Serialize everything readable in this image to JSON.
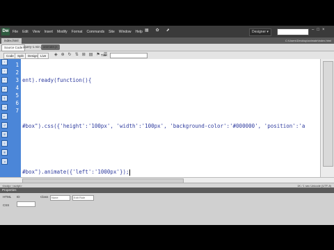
{
  "app": {
    "logo": "Dw",
    "menu": [
      "File",
      "Edit",
      "View",
      "Insert",
      "Modify",
      "Format",
      "Commands",
      "Site",
      "Window",
      "Help"
    ],
    "menu_tools": [
      "▦",
      "✿",
      "⬈"
    ],
    "workspace": "Designer ▾",
    "window_controls": [
      "–",
      "□",
      "×"
    ]
  },
  "doc": {
    "tab": "index.html",
    "path": "C:\\Users\\Desktop\\animate\\index.html",
    "related": [
      "Source Code",
      "jquery-1.min.js",
      "animate.js"
    ]
  },
  "toolbar": {
    "code": "Code",
    "split": "Split",
    "design": "Design",
    "live": "Live",
    "icons": [
      "◈",
      "⊕",
      "↻",
      "⇅",
      "⊞",
      "▤",
      "⚑",
      "☰"
    ],
    "title_label": "Title:"
  },
  "editor": {
    "line_numbers": [
      "1",
      "2",
      "3",
      "4",
      "5",
      "6",
      "7"
    ],
    "gutter_icons": [
      "*",
      "*",
      "*",
      "#",
      "¶",
      "⇥",
      "⇤",
      "↺",
      "☰",
      "≡",
      "⊞",
      "⇲"
    ],
    "lines": [
      "ent).ready(function(){",
      "",
      "#box\").css({'height':'100px', 'width':'100px', 'background-color':'#000000', 'position':'a",
      "",
      "#box\").animate({'left':'1000px'});",
      "",
      ""
    ]
  },
  "status": {
    "left": "<body> <script>",
    "right": "1K / 1 sec  Unicode (UTF-8)"
  },
  "properties": {
    "title": "Properties",
    "id_label": "ID",
    "id_value": "",
    "class_label": "Class",
    "class_value": "None",
    "edit_rule": "Edit Rule",
    "html_label": "HTML",
    "css_label": "CSS"
  },
  "colors": {
    "gutter": "#4b86d8",
    "code_text": "#2d3a9e",
    "menubar": "#3a3a3a"
  }
}
